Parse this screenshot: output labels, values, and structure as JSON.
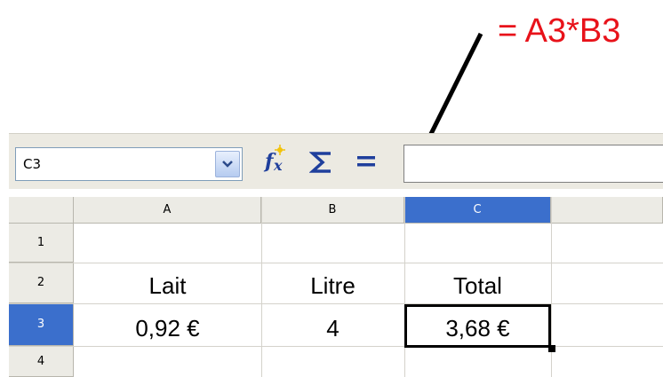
{
  "annotation": {
    "text": "= A3*B3",
    "color": "#e8121a"
  },
  "formula_bar": {
    "name_box_value": "C3",
    "equals_label": "=",
    "formula_value": ""
  },
  "icons": {
    "function_wizard": "fx-icon",
    "sum": "sigma-icon",
    "dropdown": "chevron-down-icon"
  },
  "sheet": {
    "columns": [
      "A",
      "B",
      "C"
    ],
    "rows": [
      "1",
      "2",
      "3",
      "4"
    ],
    "selected_column": "C",
    "selected_row": "3",
    "cells": {
      "A2": "Lait",
      "B2": "Litre",
      "C2": "Total",
      "A3": "0,92 €",
      "B3": "4",
      "C3": "3,68 €"
    }
  },
  "colors": {
    "selection_header": "#3b6fcc",
    "header_bg": "#ecebe5"
  }
}
